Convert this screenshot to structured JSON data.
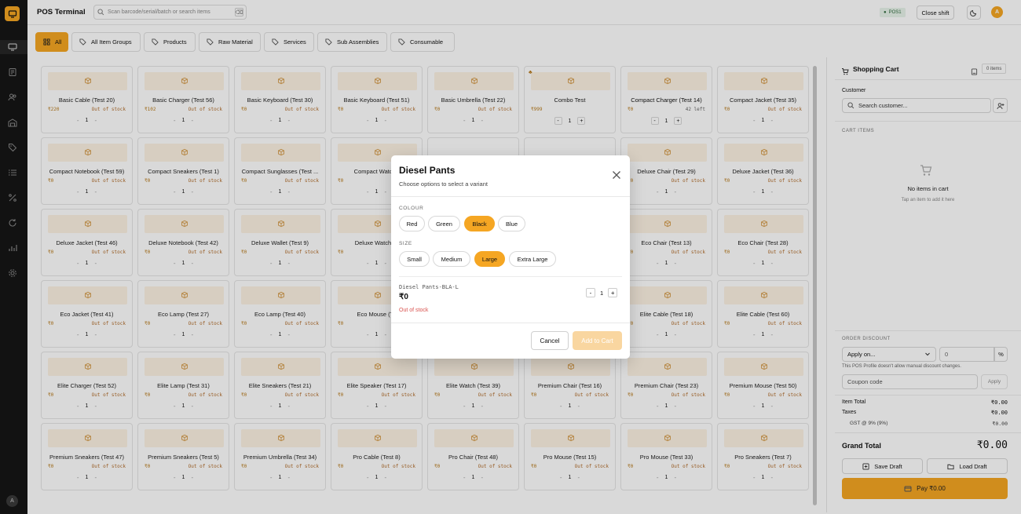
{
  "app": {
    "title": "POS Terminal"
  },
  "search": {
    "placeholder": "Scan barcode/serial/batch or search items"
  },
  "header": {
    "pos_badge": "POS1",
    "close_shift": "Close shift",
    "avatar_initial": "A"
  },
  "sidebar": {
    "avatar_initial": "A"
  },
  "categories": [
    "All",
    "All Item Groups",
    "Products",
    "Raw Material",
    "Services",
    "Sub Assemblies",
    "Consumable"
  ],
  "products": [
    {
      "name": "Basic Cable (Test 20)",
      "price": "₹220",
      "stock": "Out of stock",
      "qty": "1"
    },
    {
      "name": "Basic Charger (Test 56)",
      "price": "₹102",
      "stock": "Out of stock",
      "qty": "1"
    },
    {
      "name": "Basic Keyboard (Test 30)",
      "price": "₹0",
      "stock": "Out of stock",
      "qty": "1"
    },
    {
      "name": "Basic Keyboard (Test 51)",
      "price": "₹0",
      "stock": "Out of stock",
      "qty": "1"
    },
    {
      "name": "Basic Umbrella (Test 22)",
      "price": "₹0",
      "stock": "Out of stock",
      "qty": "1"
    },
    {
      "name": "Combo Test",
      "price": "₹999",
      "stock": "",
      "qty": "1",
      "bundle": true
    },
    {
      "name": "Compact Charger (Test 14)",
      "price": "₹0",
      "stock": "42 left",
      "qty": "1",
      "instock": true
    },
    {
      "name": "Compact Jacket (Test 35)",
      "price": "₹0",
      "stock": "Out of stock",
      "qty": "1"
    },
    {
      "name": "Compact Notebook (Test 59)",
      "price": "₹0",
      "stock": "Out of stock",
      "qty": "1"
    },
    {
      "name": "Compact Sneakers (Test 1)",
      "price": "₹0",
      "stock": "Out of stock",
      "qty": "1"
    },
    {
      "name": "Compact Sunglasses (Test ...",
      "price": "₹0",
      "stock": "Out of stock",
      "qty": "1"
    },
    {
      "name": "Compact Watch (",
      "price": "₹0",
      "stock": "",
      "qty": "1"
    },
    {
      "name": "",
      "price": "",
      "stock": "",
      "qty": ""
    },
    {
      "name": "",
      "price": "",
      "stock": "",
      "qty": ""
    },
    {
      "name": "Deluxe Chair (Test 29)",
      "price": "₹0",
      "stock": "Out of stock",
      "qty": "1"
    },
    {
      "name": "Deluxe Jacket (Test 36)",
      "price": "₹0",
      "stock": "Out of stock",
      "qty": "1"
    },
    {
      "name": "Deluxe Jacket (Test 46)",
      "price": "₹0",
      "stock": "Out of stock",
      "qty": "1"
    },
    {
      "name": "Deluxe Notebook (Test 42)",
      "price": "₹0",
      "stock": "Out of stock",
      "qty": "1"
    },
    {
      "name": "Deluxe Wallet (Test 9)",
      "price": "₹0",
      "stock": "Out of stock",
      "qty": "1"
    },
    {
      "name": "Deluxe Watch (T",
      "price": "₹0",
      "stock": "",
      "qty": "1"
    },
    {
      "name": "",
      "price": "",
      "stock": "",
      "qty": ""
    },
    {
      "name": "",
      "price": "",
      "stock": "",
      "qty": ""
    },
    {
      "name": "Eco Chair (Test 13)",
      "price": "₹0",
      "stock": "Out of stock",
      "qty": "1"
    },
    {
      "name": "Eco Chair (Test 28)",
      "price": "₹0",
      "stock": "Out of stock",
      "qty": "1"
    },
    {
      "name": "Eco Jacket (Test 41)",
      "price": "₹0",
      "stock": "Out of stock",
      "qty": "1"
    },
    {
      "name": "Eco Lamp (Test 27)",
      "price": "₹0",
      "stock": "Out of stock",
      "qty": "1"
    },
    {
      "name": "Eco Lamp (Test 40)",
      "price": "₹0",
      "stock": "Out of stock",
      "qty": "1"
    },
    {
      "name": "Eco Mouse (Te",
      "price": "₹0",
      "stock": "",
      "qty": "1"
    },
    {
      "name": "",
      "price": "",
      "stock": "",
      "qty": ""
    },
    {
      "name": "",
      "price": "",
      "stock": "",
      "qty": ""
    },
    {
      "name": "Elite Cable (Test 18)",
      "price": "₹0",
      "stock": "Out of stock",
      "qty": "1"
    },
    {
      "name": "Elite Cable (Test 60)",
      "price": "₹0",
      "stock": "Out of stock",
      "qty": "1"
    },
    {
      "name": "Elite Charger (Test 52)",
      "price": "₹0",
      "stock": "Out of stock",
      "qty": "1"
    },
    {
      "name": "Elite Lamp (Test 31)",
      "price": "₹0",
      "stock": "Out of stock",
      "qty": "1"
    },
    {
      "name": "Elite Sneakers (Test 21)",
      "price": "₹0",
      "stock": "Out of stock",
      "qty": "1"
    },
    {
      "name": "Elite Speaker (Test 17)",
      "price": "₹0",
      "stock": "Out of stock",
      "qty": "1"
    },
    {
      "name": "Elite Watch (Test 39)",
      "price": "₹0",
      "stock": "Out of stock",
      "qty": "1"
    },
    {
      "name": "Premium Chair (Test 16)",
      "price": "₹0",
      "stock": "Out of stock",
      "qty": "1"
    },
    {
      "name": "Premium Chair (Test 23)",
      "price": "₹0",
      "stock": "Out of stock",
      "qty": "1"
    },
    {
      "name": "Premium Mouse (Test 50)",
      "price": "₹0",
      "stock": "Out of stock",
      "qty": "1"
    },
    {
      "name": "Premium Sneakers (Test 47)",
      "price": "₹0",
      "stock": "Out of stock",
      "qty": "1"
    },
    {
      "name": "Premium Sneakers (Test 5)",
      "price": "₹0",
      "stock": "Out of stock",
      "qty": "1"
    },
    {
      "name": "Premium Umbrella (Test 34)",
      "price": "₹0",
      "stock": "Out of stock",
      "qty": "1"
    },
    {
      "name": "Pro Cable (Test 8)",
      "price": "₹0",
      "stock": "Out of stock",
      "qty": "1"
    },
    {
      "name": "Pro Chair (Test 48)",
      "price": "₹0",
      "stock": "Out of stock",
      "qty": "1"
    },
    {
      "name": "Pro Mouse (Test 15)",
      "price": "₹0",
      "stock": "Out of stock",
      "qty": "1"
    },
    {
      "name": "Pro Mouse (Test 33)",
      "price": "₹0",
      "stock": "Out of stock",
      "qty": "1"
    },
    {
      "name": "Pro Sneakers (Test 7)",
      "price": "₹0",
      "stock": "Out of stock",
      "qty": "1"
    }
  ],
  "cart": {
    "title": "Shopping Cart",
    "items_badge": "0 items",
    "customer_label": "Customer",
    "customer_placeholder": "Search customer...",
    "cart_items_label": "CART ITEMS",
    "empty_title": "No items in cart",
    "empty_sub": "Tap an item to add it here",
    "order_discount_label": "ORDER DISCOUNT",
    "discount_select": "Apply on...",
    "discount_value": "0",
    "discount_unit": "%",
    "discount_note": "This POS Profile doesn't allow manual discount changes.",
    "coupon_placeholder": "Coupon code",
    "apply_label": "Apply",
    "item_total_label": "Item Total",
    "item_total": "₹0.00",
    "taxes_label": "Taxes",
    "taxes": "₹0.00",
    "gst_label": "GST @ 9% (9%)",
    "gst": "₹0.00",
    "grand_total_label": "Grand Total",
    "grand_total": "₹0.00",
    "save_draft": "Save Draft",
    "load_draft": "Load Draft",
    "pay": "Pay ₹0.00"
  },
  "modal": {
    "title": "Diesel Pants",
    "subtitle": "Choose options to select a variant",
    "colour_label": "COLOUR",
    "colours": [
      "Red",
      "Green",
      "Black",
      "Blue"
    ],
    "colour_selected": "Black",
    "size_label": "SIZE",
    "sizes": [
      "Small",
      "Medium",
      "Large",
      "Extra Large"
    ],
    "size_selected": "Large",
    "sku": "Diesel Pants-BLA-L",
    "price": "₹0",
    "stock": "Out of stock",
    "qty": "1",
    "cancel": "Cancel",
    "add_to_cart": "Add to Cart"
  },
  "colors": {
    "accent": "#f5a623",
    "sidebar": "#161616",
    "danger": "#d9534f"
  }
}
